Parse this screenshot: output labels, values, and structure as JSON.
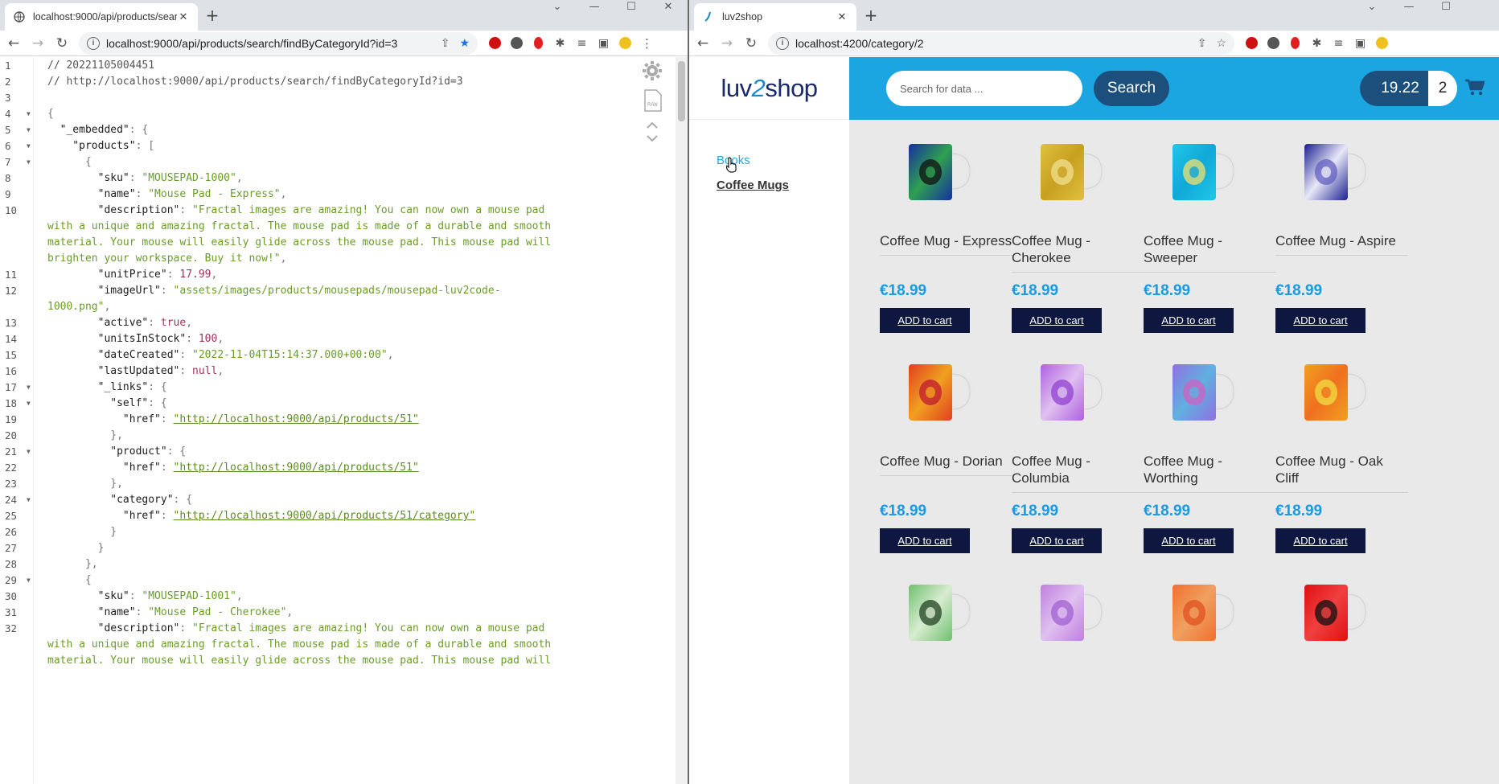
{
  "left_window": {
    "tab_title": "localhost:9000/api/products/sear",
    "url": "localhost:9000/api/products/search/findByCategoryId?id=3",
    "json_lines": [
      {
        "n": "1",
        "fold": false,
        "parts": [
          {
            "t": "// 20221105004451",
            "c": "c"
          }
        ]
      },
      {
        "n": "2",
        "fold": false,
        "parts": [
          {
            "t": "// http://localhost:9000/api/products/search/findByCategoryId?id=3",
            "c": "c"
          }
        ]
      },
      {
        "n": "3",
        "fold": false,
        "parts": []
      },
      {
        "n": "4",
        "fold": true,
        "parts": [
          {
            "t": "{",
            "c": "p"
          }
        ]
      },
      {
        "n": "5",
        "fold": true,
        "parts": [
          {
            "t": "  \"_embedded\"",
            "c": "k"
          },
          {
            "t": ": {",
            "c": "p"
          }
        ]
      },
      {
        "n": "6",
        "fold": true,
        "parts": [
          {
            "t": "    \"products\"",
            "c": "k"
          },
          {
            "t": ": [",
            "c": "p"
          }
        ]
      },
      {
        "n": "7",
        "fold": true,
        "parts": [
          {
            "t": "      {",
            "c": "p"
          }
        ]
      },
      {
        "n": "8",
        "fold": false,
        "parts": [
          {
            "t": "        \"sku\"",
            "c": "k"
          },
          {
            "t": ": ",
            "c": "p"
          },
          {
            "t": "\"MOUSEPAD-1000\"",
            "c": "s"
          },
          {
            "t": ",",
            "c": "p"
          }
        ]
      },
      {
        "n": "9",
        "fold": false,
        "parts": [
          {
            "t": "        \"name\"",
            "c": "k"
          },
          {
            "t": ": ",
            "c": "p"
          },
          {
            "t": "\"Mouse Pad - Express\"",
            "c": "s"
          },
          {
            "t": ",",
            "c": "p"
          }
        ]
      },
      {
        "n": "10",
        "fold": false,
        "parts": [
          {
            "t": "        \"description\"",
            "c": "k"
          },
          {
            "t": ": ",
            "c": "p"
          },
          {
            "t": "\"Fractal images are amazing! You can now own a mouse pad",
            "c": "s"
          }
        ]
      },
      {
        "n": "",
        "fold": false,
        "parts": [
          {
            "t": "with a unique and amazing fractal. The mouse pad is made of a durable and smooth",
            "c": "s"
          }
        ]
      },
      {
        "n": "",
        "fold": false,
        "parts": [
          {
            "t": "material. Your mouse will easily glide across the mouse pad. This mouse pad will",
            "c": "s"
          }
        ]
      },
      {
        "n": "",
        "fold": false,
        "parts": [
          {
            "t": "brighten your workspace. Buy it now!\"",
            "c": "s"
          },
          {
            "t": ",",
            "c": "p"
          }
        ]
      },
      {
        "n": "11",
        "fold": false,
        "parts": [
          {
            "t": "        \"unitPrice\"",
            "c": "k"
          },
          {
            "t": ": ",
            "c": "p"
          },
          {
            "t": "17.99",
            "c": "n"
          },
          {
            "t": ",",
            "c": "p"
          }
        ]
      },
      {
        "n": "12",
        "fold": false,
        "parts": [
          {
            "t": "        \"imageUrl\"",
            "c": "k"
          },
          {
            "t": ": ",
            "c": "p"
          },
          {
            "t": "\"assets/images/products/mousepads/mousepad-luv2code-",
            "c": "s"
          }
        ]
      },
      {
        "n": "",
        "fold": false,
        "parts": [
          {
            "t": "1000.png\"",
            "c": "s"
          },
          {
            "t": ",",
            "c": "p"
          }
        ]
      },
      {
        "n": "13",
        "fold": false,
        "parts": [
          {
            "t": "        \"active\"",
            "c": "k"
          },
          {
            "t": ": ",
            "c": "p"
          },
          {
            "t": "true",
            "c": "b"
          },
          {
            "t": ",",
            "c": "p"
          }
        ]
      },
      {
        "n": "14",
        "fold": false,
        "parts": [
          {
            "t": "        \"unitsInStock\"",
            "c": "k"
          },
          {
            "t": ": ",
            "c": "p"
          },
          {
            "t": "100",
            "c": "n"
          },
          {
            "t": ",",
            "c": "p"
          }
        ]
      },
      {
        "n": "15",
        "fold": false,
        "parts": [
          {
            "t": "        \"dateCreated\"",
            "c": "k"
          },
          {
            "t": ": ",
            "c": "p"
          },
          {
            "t": "\"2022-11-04T15:14:37.000+00:00\"",
            "c": "s"
          },
          {
            "t": ",",
            "c": "p"
          }
        ]
      },
      {
        "n": "16",
        "fold": false,
        "parts": [
          {
            "t": "        \"lastUpdated\"",
            "c": "k"
          },
          {
            "t": ": ",
            "c": "p"
          },
          {
            "t": "null",
            "c": "b"
          },
          {
            "t": ",",
            "c": "p"
          }
        ]
      },
      {
        "n": "17",
        "fold": true,
        "parts": [
          {
            "t": "        \"_links\"",
            "c": "k"
          },
          {
            "t": ": {",
            "c": "p"
          }
        ]
      },
      {
        "n": "18",
        "fold": true,
        "parts": [
          {
            "t": "          \"self\"",
            "c": "k"
          },
          {
            "t": ": {",
            "c": "p"
          }
        ]
      },
      {
        "n": "19",
        "fold": false,
        "parts": [
          {
            "t": "            \"href\"",
            "c": "k"
          },
          {
            "t": ": ",
            "c": "p"
          },
          {
            "t": "\"http://localhost:9000/api/products/51\"",
            "c": "lnk"
          }
        ]
      },
      {
        "n": "20",
        "fold": false,
        "parts": [
          {
            "t": "          },",
            "c": "p"
          }
        ]
      },
      {
        "n": "21",
        "fold": true,
        "parts": [
          {
            "t": "          \"product\"",
            "c": "k"
          },
          {
            "t": ": {",
            "c": "p"
          }
        ]
      },
      {
        "n": "22",
        "fold": false,
        "parts": [
          {
            "t": "            \"href\"",
            "c": "k"
          },
          {
            "t": ": ",
            "c": "p"
          },
          {
            "t": "\"http://localhost:9000/api/products/51\"",
            "c": "lnk"
          }
        ]
      },
      {
        "n": "23",
        "fold": false,
        "parts": [
          {
            "t": "          },",
            "c": "p"
          }
        ]
      },
      {
        "n": "24",
        "fold": true,
        "parts": [
          {
            "t": "          \"category\"",
            "c": "k"
          },
          {
            "t": ": {",
            "c": "p"
          }
        ]
      },
      {
        "n": "25",
        "fold": false,
        "parts": [
          {
            "t": "            \"href\"",
            "c": "k"
          },
          {
            "t": ": ",
            "c": "p"
          },
          {
            "t": "\"http://localhost:9000/api/products/51/category\"",
            "c": "lnk"
          }
        ]
      },
      {
        "n": "26",
        "fold": false,
        "parts": [
          {
            "t": "          }",
            "c": "p"
          }
        ]
      },
      {
        "n": "27",
        "fold": false,
        "parts": [
          {
            "t": "        }",
            "c": "p"
          }
        ]
      },
      {
        "n": "28",
        "fold": false,
        "parts": [
          {
            "t": "      },",
            "c": "p"
          }
        ]
      },
      {
        "n": "29",
        "fold": true,
        "parts": [
          {
            "t": "      {",
            "c": "p"
          }
        ]
      },
      {
        "n": "30",
        "fold": false,
        "parts": [
          {
            "t": "        \"sku\"",
            "c": "k"
          },
          {
            "t": ": ",
            "c": "p"
          },
          {
            "t": "\"MOUSEPAD-1001\"",
            "c": "s"
          },
          {
            "t": ",",
            "c": "p"
          }
        ]
      },
      {
        "n": "31",
        "fold": false,
        "parts": [
          {
            "t": "        \"name\"",
            "c": "k"
          },
          {
            "t": ": ",
            "c": "p"
          },
          {
            "t": "\"Mouse Pad - Cherokee\"",
            "c": "s"
          },
          {
            "t": ",",
            "c": "p"
          }
        ]
      },
      {
        "n": "32",
        "fold": false,
        "parts": [
          {
            "t": "        \"description\"",
            "c": "k"
          },
          {
            "t": ": ",
            "c": "p"
          },
          {
            "t": "\"Fractal images are amazing! You can now own a mouse pad",
            "c": "s"
          }
        ]
      },
      {
        "n": "",
        "fold": false,
        "parts": [
          {
            "t": "with a unique and amazing fractal. The mouse pad is made of a durable and smooth",
            "c": "s"
          }
        ]
      },
      {
        "n": "",
        "fold": false,
        "parts": [
          {
            "t": "material. Your mouse will easily glide across the mouse pad. This mouse pad will",
            "c": "s"
          }
        ]
      }
    ]
  },
  "right_window": {
    "tab_title": "luv2shop",
    "url": "localhost:4200/category/2",
    "logo": {
      "pre": "luv",
      "mid": "2",
      "post": "shop"
    },
    "menu": [
      {
        "label": "Books",
        "active": false
      },
      {
        "label": "Coffee Mugs",
        "active": true
      }
    ],
    "search": {
      "placeholder": "Search for data ...",
      "button": "Search"
    },
    "cart": {
      "total": "19.22",
      "count": "2"
    },
    "add_label": "ADD to cart",
    "products": [
      {
        "name": "Coffee Mug - Express",
        "price": "€18.99",
        "colors": [
          "#1530a0",
          "#2fa050",
          "#101010"
        ]
      },
      {
        "name": "Coffee Mug - Cherokee",
        "price": "€18.99",
        "colors": [
          "#e0c040",
          "#c8a020",
          "#f0e090"
        ]
      },
      {
        "name": "Coffee Mug - Sweeper",
        "price": "€18.99",
        "colors": [
          "#20c8e8",
          "#10a8d8",
          "#f0e070"
        ]
      },
      {
        "name": "Coffee Mug - Aspire",
        "price": "€18.99",
        "colors": [
          "#1a2090",
          "#e8e8f8",
          "#6060c0"
        ]
      },
      {
        "name": "Coffee Mug - Dorian",
        "price": "€18.99",
        "colors": [
          "#e04020",
          "#f0a020",
          "#c01830"
        ]
      },
      {
        "name": "Coffee Mug - Columbia",
        "price": "€18.99",
        "colors": [
          "#b060e0",
          "#e0c0f0",
          "#9040d0"
        ]
      },
      {
        "name": "Coffee Mug - Worthing",
        "price": "€18.99",
        "colors": [
          "#9070e0",
          "#60b0e0",
          "#d060c0"
        ]
      },
      {
        "name": "Coffee Mug - Oak Cliff",
        "price": "€18.99",
        "colors": [
          "#f0a020",
          "#f07020",
          "#f0e040"
        ]
      },
      {
        "name": "",
        "price": "",
        "colors": [
          "#70c070",
          "#d8ecd0",
          "#204020"
        ]
      },
      {
        "name": "",
        "price": "",
        "colors": [
          "#c080e0",
          "#e0c0f0",
          "#a060d0"
        ]
      },
      {
        "name": "",
        "price": "",
        "colors": [
          "#f07030",
          "#f0a060",
          "#e05020"
        ]
      },
      {
        "name": "",
        "price": "",
        "colors": [
          "#e01010",
          "#f04040",
          "#101010"
        ]
      }
    ]
  },
  "colors": {
    "topbar": "#1ba6e2",
    "button_dark": "#1c4f7c",
    "add_button": "#0d1740",
    "price": "#1a9ae0",
    "content_bg": "#e9e9e9"
  }
}
